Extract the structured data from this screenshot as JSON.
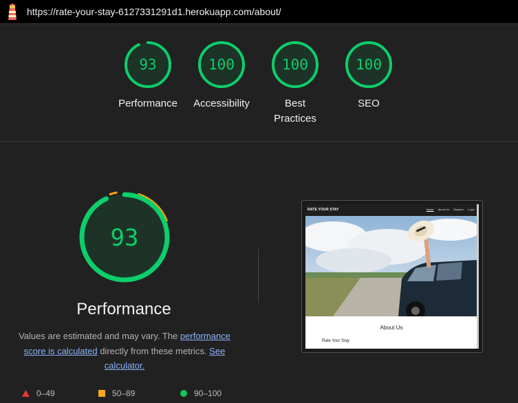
{
  "url": "https://rate-your-stay-6127331291d1.herokuapp.com/about/",
  "gauges": [
    {
      "score": "93",
      "label": "Performance"
    },
    {
      "score": "100",
      "label": "Accessibility"
    },
    {
      "score": "100",
      "label": "Best Practices"
    },
    {
      "score": "100",
      "label": "SEO"
    }
  ],
  "main": {
    "score": "93",
    "title": "Performance",
    "desc_prefix": "Values are estimated and may vary. The ",
    "link1": "performance score is calculated",
    "desc_mid": " directly from these metrics. ",
    "link2": "See calculator."
  },
  "legend": [
    {
      "range": "0–49",
      "color": "#e53935",
      "icon": "triangle-icon"
    },
    {
      "range": "50–89",
      "color": "#f9a825",
      "icon": "square-icon"
    },
    {
      "range": "90–100",
      "color": "#12c45a",
      "icon": "circle-icon"
    }
  ],
  "screenshot": {
    "brand": "RATE YOUR STAY",
    "menu": [
      "Home",
      "About Us",
      "Register",
      "Login"
    ],
    "heading": "About Us",
    "subtext": "Rate Your Stay"
  },
  "colors": {
    "pass": "#0cce6b",
    "average": "#ffa400",
    "fail": "#ff4e42"
  }
}
